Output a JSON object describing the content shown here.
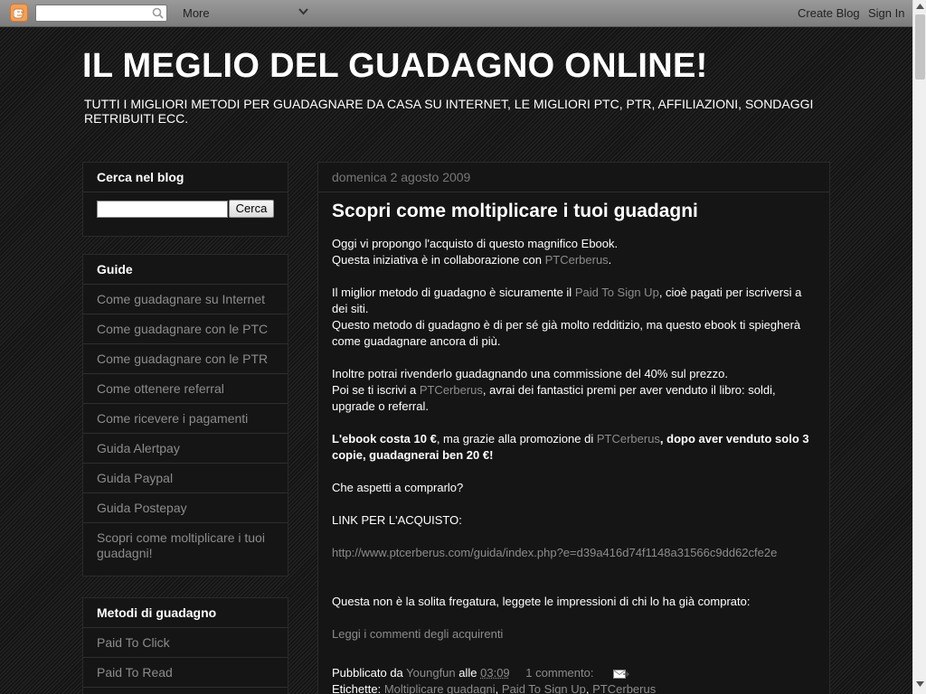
{
  "navbar": {
    "more_label": "More",
    "create_blog": "Create Blog",
    "sign_in": "Sign In"
  },
  "header": {
    "title": "IL MEGLIO DEL GUADAGNO ONLINE!",
    "description": "TUTTI I MIGLIORI METODI PER GUADAGNARE DA CASA SU INTERNET, LE MIGLIORI PTC, PTR, AFFILIAZIONI, SONDAGGI RETRIBUITI ECC."
  },
  "search_widget": {
    "title": "Cerca nel blog",
    "button": "Cerca"
  },
  "guide_widget": {
    "title": "Guide",
    "items": [
      "Come guadagnare su Internet",
      "Come guadagnare con le PTC",
      "Come guadagnare con le PTR",
      "Come ottenere referral",
      "Come ricevere i pagamenti",
      "Guida Alertpay",
      "Guida Paypal",
      "Guida Postepay",
      "Scopri come moltiplicare i tuoi guadagni!"
    ]
  },
  "methods_widget": {
    "title": "Metodi di guadagno",
    "items": [
      "Paid To Click",
      "Paid To Read"
    ]
  },
  "post": {
    "date": "domenica 2 agosto 2009",
    "title": "Scopri come moltiplicare i tuoi guadagni",
    "p1a": "Oggi vi propongo l'acquisto di questo magnifico Ebook.",
    "p1b": "Questa iniziativa è in collaborazione con ",
    "ptcerberus": "PTCerberus",
    "dot": ".",
    "p2a": "Il miglior metodo di guadagno è sicuramente il ",
    "paid_to_signup": "Paid To Sign Up",
    "p2b": ", cioè pagati per iscriversi a dei siti.",
    "p2c": "Questo metodo di guadagno è di per sé già molto redditizio, ma questo ebook ti spiegherà come guadagnare ancora di più.",
    "p3a": "Inoltre potrai rivenderlo guadagnando una commissione del 40% sul prezzo.",
    "p3b": "Poi se ti iscrivi a ",
    "p3c": ", avrai dei fantastici premi per aver venduto il libro: soldi, upgrade o referral.",
    "p4_bold1": "L'ebook costa 10 €",
    "p4a": ", ma grazie alla promozione di ",
    "p4_bold2": ", dopo aver venduto solo 3 copie, guadagnerai ben 20 €!",
    "p5": "Che aspetti a comprarlo?",
    "p6": "LINK PER L'ACQUISTO:",
    "purchase_url": "http://www.ptcerberus.com/guida/index.php?e=d39a416d74f1148a31566c9dd62cfe2e",
    "p7": "Questa non è la solita fregatura, leggete le impressioni di chi lo ha già comprato:",
    "reviews_link": "Leggi i commenti degli acquirenti",
    "posted_by": "Pubblicato da ",
    "author": "Youngfun",
    "at": " alle ",
    "time": "03:09",
    "comments": "1 commento:",
    "labels_title": "Etichette: ",
    "labels": [
      "Moltiplicare guadagni",
      "Paid To Sign Up",
      "PTCerberus"
    ]
  }
}
